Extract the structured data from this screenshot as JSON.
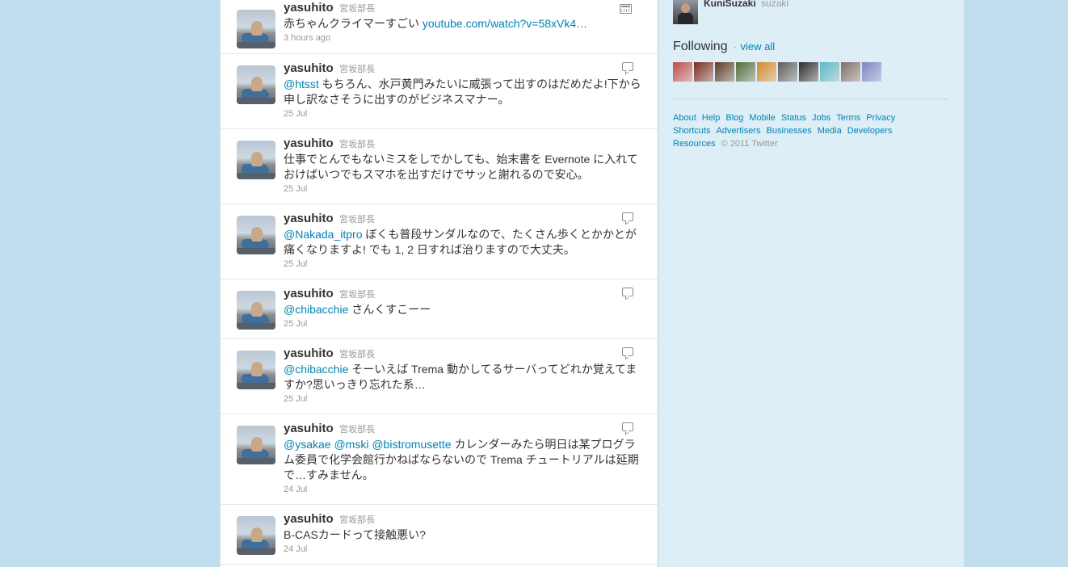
{
  "timeline": {
    "tweets": [
      {
        "screen_name": "yasuhito",
        "full_name": "宮坂部長",
        "time": "3 hours ago",
        "mentions": [],
        "text": "赤ちゃんクライマーすごい",
        "link": "youtube.com/watch?v=58xVk4…",
        "icon": "media-icon"
      },
      {
        "screen_name": "yasuhito",
        "full_name": "宮坂部長",
        "time": "25 Jul",
        "mentions": [
          "@htsst"
        ],
        "text": "もちろん、水戸黄門みたいに威張って出すのはだめだよ!下から申し訳なさそうに出すのがビジネスマナー。",
        "link": "",
        "icon": "reply-icon"
      },
      {
        "screen_name": "yasuhito",
        "full_name": "宮坂部長",
        "time": "25 Jul",
        "mentions": [],
        "text": "仕事でとんでもないミスをしでかしても、始末書を Evernote に入れておけばいつでもスマホを出すだけでサッと謝れるので安心。",
        "link": "",
        "icon": ""
      },
      {
        "screen_name": "yasuhito",
        "full_name": "宮坂部長",
        "time": "25 Jul",
        "mentions": [
          "@Nakada_itpro"
        ],
        "text": "ぼくも普段サンダルなので、たくさん歩くとかかとが痛くなりますよ! でも 1, 2 日すれば治りますので大丈夫。",
        "link": "",
        "icon": "reply-icon"
      },
      {
        "screen_name": "yasuhito",
        "full_name": "宮坂部長",
        "time": "25 Jul",
        "mentions": [
          "@chibacchie"
        ],
        "text": "さんくすこーー",
        "link": "",
        "icon": "reply-icon"
      },
      {
        "screen_name": "yasuhito",
        "full_name": "宮坂部長",
        "time": "25 Jul",
        "mentions": [
          "@chibacchie"
        ],
        "text": "そーいえば Trema 動かしてるサーバってどれか覚えてますか?思いっきり忘れた系…",
        "link": "",
        "icon": "reply-icon"
      },
      {
        "screen_name": "yasuhito",
        "full_name": "宮坂部長",
        "time": "24 Jul",
        "mentions": [
          "@ysakae",
          "@mski",
          "@bistromusette"
        ],
        "text": "カレンダーみたら明日は某プログラム委員で化学会館行かねばならないので Trema チュートリアルは延期で…すみません。",
        "link": "",
        "icon": "reply-icon"
      },
      {
        "screen_name": "yasuhito",
        "full_name": "宮坂部長",
        "time": "24 Jul",
        "mentions": [],
        "text": "B-CASカードって接触悪い?",
        "link": "",
        "icon": ""
      }
    ]
  },
  "dashboard": {
    "profile": {
      "name": "KuniSuzaki",
      "handle": "suzaki"
    },
    "following": {
      "title": "Following",
      "separator": "·",
      "view_all": "view all",
      "avatar_colors": [
        "#c24a4a",
        "#7a2b1c",
        "#5a3b22",
        "#4f6b3a",
        "#d38a2a",
        "#5b5b5b",
        "#2b2b2b",
        "#58b8c8",
        "#7e6f66",
        "#7a86c8"
      ]
    },
    "footer": {
      "links": [
        "About",
        "Help",
        "Blog",
        "Mobile",
        "Status",
        "Jobs",
        "Terms",
        "Privacy",
        "Shortcuts",
        "Advertisers",
        "Businesses",
        "Media",
        "Developers",
        "Resources"
      ],
      "copyright": "© 2011 Twitter"
    }
  }
}
